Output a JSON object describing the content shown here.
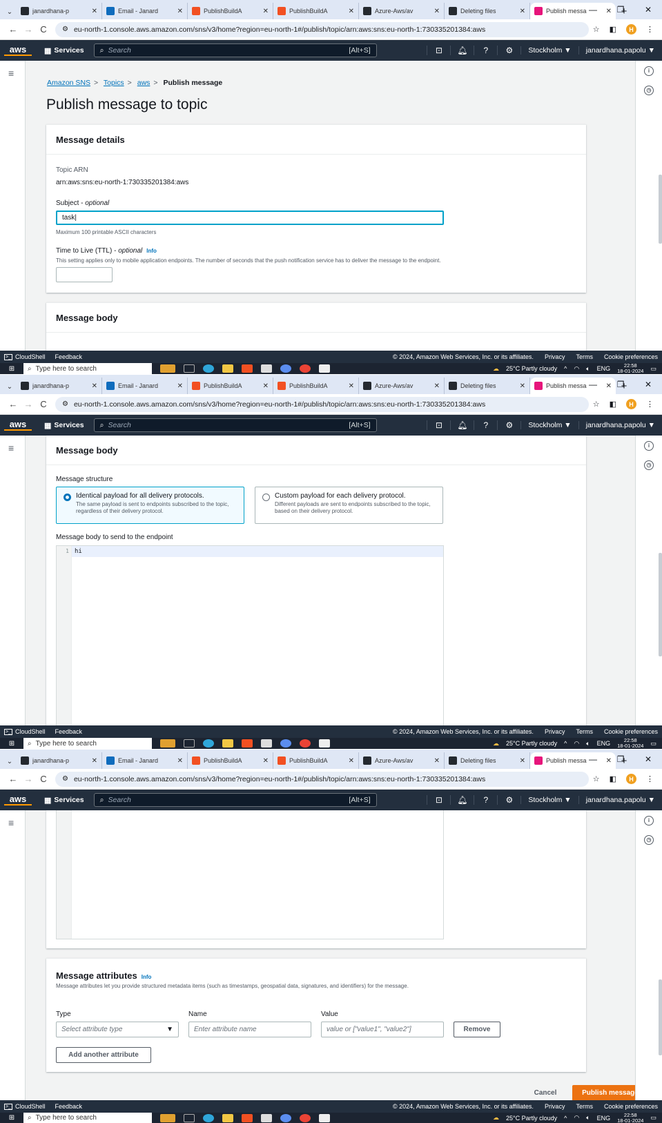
{
  "browser": {
    "tabs": [
      {
        "label": "janardhana-p",
        "icon": "github-icon",
        "active": false
      },
      {
        "label": "Email - Janard",
        "icon": "outlook-icon",
        "active": false
      },
      {
        "label": "PublishBuildA",
        "icon": "microsoft-icon",
        "active": false
      },
      {
        "label": "PublishBuildA",
        "icon": "microsoft-icon",
        "active": false
      },
      {
        "label": "Azure-Aws/av",
        "icon": "github-icon",
        "active": false
      },
      {
        "label": "Deleting files",
        "icon": "github-icon",
        "active": false
      },
      {
        "label": "Publish messa",
        "icon": "aws-sns-icon",
        "active": true
      }
    ],
    "url": "eu-north-1.console.aws.amazon.com/sns/v3/home?region=eu-north-1#/publish/topic/arn:aws:sns:eu-north-1:730335201384:aws",
    "profile_initial": "H"
  },
  "aws_header": {
    "logo": "aws",
    "services": "Services",
    "search_placeholder": "Search",
    "shortcut": "[Alt+S]",
    "region": "Stockholm ▼",
    "user": "janardhana.papolu ▼"
  },
  "breadcrumb": {
    "sns": "Amazon SNS",
    "topics": "Topics",
    "topic": "aws",
    "current": "Publish message"
  },
  "page_title": "Publish message to topic",
  "details": {
    "header": "Message details",
    "arn_label": "Topic ARN",
    "arn_value": "arn:aws:sns:eu-north-1:730335201384:aws",
    "subject_label": "Subject - ",
    "subject_optional": "optional",
    "subject_value": "task",
    "subject_hint": "Maximum 100 printable ASCII characters",
    "ttl_label": "Time to Live (TTL) - ",
    "ttl_optional": "optional",
    "info": "Info",
    "ttl_hint": "This setting applies only to mobile application endpoints. The number of seconds that the push notification service has to deliver the message to the endpoint."
  },
  "body": {
    "header": "Message body",
    "structure_label": "Message structure",
    "opt1_title": "Identical payload for all delivery protocols.",
    "opt1_desc": "The same payload is sent to endpoints subscribed to the topic, regardless of their delivery protocol.",
    "opt2_title": "Custom payload for each delivery protocol.",
    "opt2_desc": "Different payloads are sent to endpoints subscribed to the topic, based on their delivery protocol.",
    "endpoint_label": "Message body to send to the endpoint",
    "line_number": "1",
    "code": "hi"
  },
  "attributes": {
    "header": "Message attributes",
    "info": "Info",
    "desc": "Message attributes let you provide structured metadata items (such as timestamps, geospatial data, signatures, and identifiers) for the message.",
    "type_label": "Type",
    "type_placeholder": "Select attribute type",
    "name_label": "Name",
    "name_placeholder": "Enter attribute name",
    "value_label": "Value",
    "value_placeholder": "value or [\"value1\", \"value2\"]",
    "remove": "Remove",
    "add": "Add another attribute"
  },
  "actions": {
    "cancel": "Cancel",
    "publish": "Publish message"
  },
  "footer": {
    "cloudshell": "CloudShell",
    "feedback": "Feedback",
    "copyright": "© 2024, Amazon Web Services, Inc. or its affiliates.",
    "privacy": "Privacy",
    "terms": "Terms",
    "cookies": "Cookie preferences"
  },
  "taskbar": {
    "search": "Type here to search",
    "weather": "25°C  Partly cloudy",
    "lang": "ENG",
    "time": "22:58",
    "date": "18-01-2024"
  },
  "colors": {
    "aws_dark": "#232f3e",
    "aws_orange": "#ec7211",
    "link": "#0073bb"
  }
}
